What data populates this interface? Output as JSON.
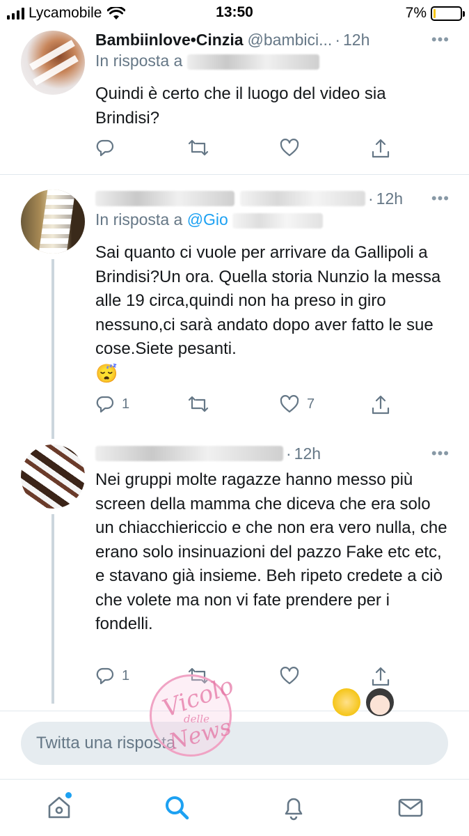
{
  "status_bar": {
    "carrier": "Lycamobile",
    "time": "13:50",
    "battery": "7%",
    "battery_level": 0.07,
    "battery_color": "#f5c518"
  },
  "tweets": [
    {
      "name": "Bambiinlove•Cinzia",
      "handle": "@bambici...",
      "separator": "·",
      "time": "12h",
      "more": "•••",
      "reply_prefix": "In risposta a",
      "text": "Quindi è certo che il luogo del video sia Brindisi?",
      "actions": {
        "reply_icon": "reply-icon",
        "retweet_icon": "retweet-icon",
        "like_icon": "heart-icon",
        "share_icon": "share-icon"
      }
    },
    {
      "separator": "·",
      "time": "12h",
      "more": "•••",
      "reply_prefix": "In risposta a",
      "reply_mention": "@Gio",
      "text": "Sai quanto ci vuole per arrivare da Gallipoli a Brindisi?Un ora. Quella storia Nunzio la messa alle 19 circa,quindi non ha preso in giro nessuno,ci sarà andato dopo aver fatto le sue cose.Siete pesanti.",
      "emoji": "😴",
      "reply_count": "1",
      "like_count": "7"
    },
    {
      "separator": "·",
      "time": "12h",
      "more": "•••",
      "text": "Nei gruppi molte ragazze hanno messo più screen della mamma che diceva che era solo un chiacchiericcio e che non era vero nulla, che erano solo insinuazioni del pazzo Fake etc etc, e stavano già insieme. Beh ripeto credete a ciò che volete ma non vi fate prendere per i fondelli.",
      "reply_count": "1"
    }
  ],
  "reply_bar": {
    "placeholder": "Twitta una risposta"
  },
  "tab_bar": {
    "items": [
      "home-icon",
      "search-icon",
      "notifications-icon",
      "messages-icon"
    ],
    "accent": "#1da1f2"
  },
  "watermark": {
    "line1": "Vicolo",
    "line2": "delle",
    "line3": "News"
  }
}
